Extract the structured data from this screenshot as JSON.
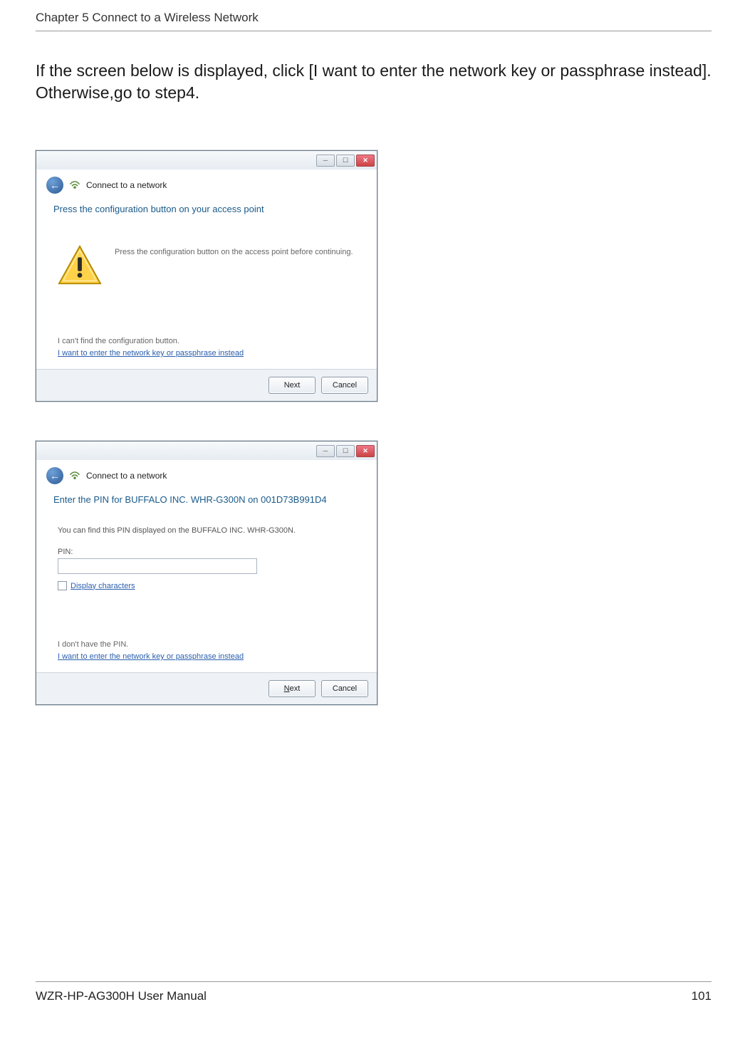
{
  "header": {
    "chapter": "Chapter 5  Connect to a Wireless Network"
  },
  "instruction": "If the screen below is displayed, click [I want to enter the network key or passphrase instead]. Otherwise,go to step4.",
  "dialog1": {
    "nav_title": "Connect to a network",
    "heading": "Press the configuration button on your access point",
    "warn_text": "Press the configuration button on the access point before continuing.",
    "help_line1": "I can't find the configuration button.",
    "help_link": "I want to enter the network key or passphrase instead",
    "next": "Next",
    "cancel": "Cancel"
  },
  "dialog2": {
    "nav_title": "Connect to a network",
    "heading": "Enter the PIN for BUFFALO INC. WHR-G300N on 001D73B991D4",
    "pin_instruction": "You can find this PIN displayed on the BUFFALO INC. WHR-G300N.",
    "pin_label": "PIN:",
    "display_chars": "Display characters",
    "help_line1": "I don't have the PIN.",
    "help_link": "I want to enter the network key or passphrase instead",
    "next_prefix": "N",
    "next_rest": "ext",
    "cancel": "Cancel"
  },
  "footer": {
    "manual": "WZR-HP-AG300H User Manual",
    "page": "101"
  }
}
